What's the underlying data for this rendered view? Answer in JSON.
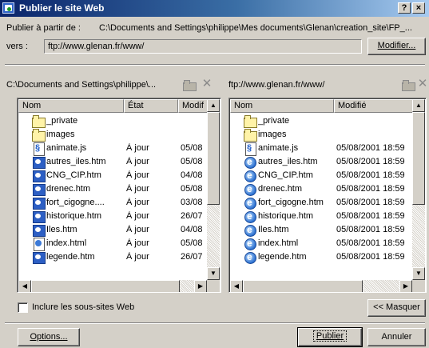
{
  "window": {
    "title": "Publier le site Web",
    "help_button": "?",
    "close_button": "×"
  },
  "source": {
    "label": "Publier à partir de :",
    "path": "C:\\Documents and Settings\\philippe\\Mes documents\\Glenan\\creation_site\\FP_..."
  },
  "destination": {
    "label": "vers :",
    "value": "ftp://www.glenan.fr/www/",
    "modify_button": "Modifier..."
  },
  "left_pane": {
    "path": "C:\\Documents and Settings\\philippe\\...",
    "columns": [
      "Nom",
      "État",
      "Modif"
    ],
    "rows": [
      {
        "icon": "folder-icon",
        "name": "_private",
        "state": "",
        "modified": ""
      },
      {
        "icon": "folder-icon",
        "name": "images",
        "state": "",
        "modified": ""
      },
      {
        "icon": "script-file-icon",
        "name": "animate.js",
        "state": "À jour",
        "modified": "05/08"
      },
      {
        "icon": "html-page-icon",
        "name": "autres_iles.htm",
        "state": "À jour",
        "modified": "05/08"
      },
      {
        "icon": "html-page-icon",
        "name": "CNG_CIP.htm",
        "state": "À jour",
        "modified": "04/08"
      },
      {
        "icon": "html-page-icon",
        "name": "drenec.htm",
        "state": "À jour",
        "modified": "05/08"
      },
      {
        "icon": "html-page-icon",
        "name": "fort_cigogne....",
        "state": "À jour",
        "modified": "03/08"
      },
      {
        "icon": "html-page-icon",
        "name": "historique.htm",
        "state": "À jour",
        "modified": "26/07"
      },
      {
        "icon": "html-page-icon",
        "name": "Iles.htm",
        "state": "À jour",
        "modified": "04/08"
      },
      {
        "icon": "html-file-icon",
        "name": "index.html",
        "state": "À jour",
        "modified": "05/08"
      },
      {
        "icon": "html-page-icon",
        "name": "legende.htm",
        "state": "À jour",
        "modified": "26/07"
      }
    ]
  },
  "right_pane": {
    "path": "ftp://www.glenan.fr/www/",
    "columns": [
      "Nom",
      "Modifié"
    ],
    "rows": [
      {
        "icon": "folder-icon",
        "name": "_private",
        "modified": ""
      },
      {
        "icon": "folder-icon",
        "name": "images",
        "modified": ""
      },
      {
        "icon": "script-file-icon",
        "name": "animate.js",
        "modified": "05/08/2001 18:59"
      },
      {
        "icon": "ie-page-icon",
        "name": "autres_iles.htm",
        "modified": "05/08/2001 18:59"
      },
      {
        "icon": "ie-page-icon",
        "name": "CNG_CIP.htm",
        "modified": "05/08/2001 18:59"
      },
      {
        "icon": "ie-page-icon",
        "name": "drenec.htm",
        "modified": "05/08/2001 18:59"
      },
      {
        "icon": "ie-page-icon",
        "name": "fort_cigogne.htm",
        "modified": "05/08/2001 18:59"
      },
      {
        "icon": "ie-page-icon",
        "name": "historique.htm",
        "modified": "05/08/2001 18:59"
      },
      {
        "icon": "ie-page-icon",
        "name": "Iles.htm",
        "modified": "05/08/2001 18:59"
      },
      {
        "icon": "ie-page-icon",
        "name": "index.html",
        "modified": "05/08/2001 18:59"
      },
      {
        "icon": "ie-page-icon",
        "name": "legende.htm",
        "modified": "05/08/2001 18:59"
      }
    ]
  },
  "options": {
    "include_subsites_label": "Inclure les sous-sites Web",
    "include_subsites_checked": false,
    "hide_button": "<< Masquer"
  },
  "footer": {
    "options_button": "Options...",
    "publish_button": "Publier",
    "cancel_button": "Annuler"
  },
  "colors": {
    "titlebar_start": "#0a246a",
    "titlebar_end": "#a6caf0",
    "dialog_face": "#d4d0c8"
  }
}
